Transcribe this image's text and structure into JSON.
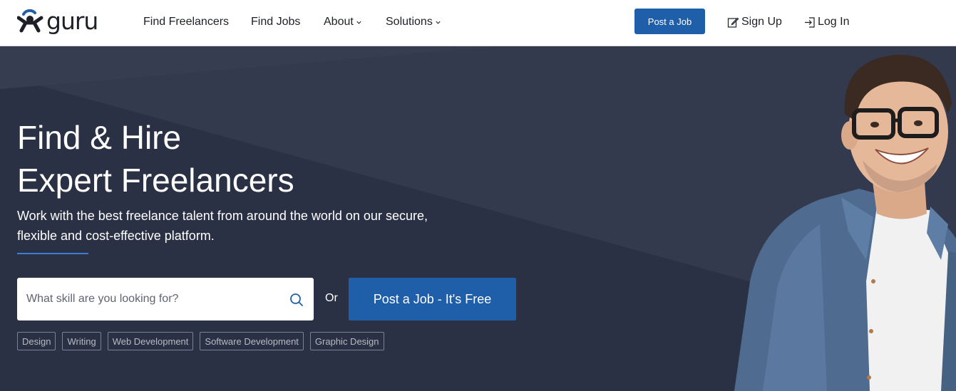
{
  "brand": {
    "name": "guru"
  },
  "nav": {
    "find_freelancers": "Find Freelancers",
    "find_jobs": "Find Jobs",
    "about": "About",
    "solutions": "Solutions"
  },
  "header_actions": {
    "post_job": "Post a Job",
    "sign_up": "Sign Up",
    "log_in": "Log In"
  },
  "hero": {
    "title_line1": "Find & Hire",
    "title_line2": "Expert Freelancers",
    "subtitle": "Work with the best freelance talent from around the world on our secure, flexible and cost-effective platform.",
    "search_placeholder": "What skill are you looking for?",
    "or_text": "Or",
    "cta": "Post a Job - It's Free",
    "tags": [
      "Design",
      "Writing",
      "Web Development",
      "Software Development",
      "Graphic Design"
    ]
  },
  "colors": {
    "accent": "#1f5ea8",
    "hero_bg": "#2d3346",
    "underline": "#3c7dd4"
  },
  "icons": {
    "logo": "guru-logo-mark",
    "caret": "chevron-down-icon",
    "sign_up": "edit-icon",
    "log_in": "login-icon",
    "search": "search-icon"
  }
}
